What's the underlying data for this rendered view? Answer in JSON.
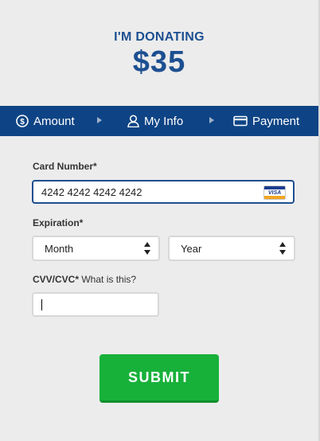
{
  "header": {
    "title": "I'M DONATING",
    "amount": "$35"
  },
  "steps": [
    {
      "label": "Amount",
      "icon": "dollar-circle-icon"
    },
    {
      "label": "My Info",
      "icon": "person-icon"
    },
    {
      "label": "Payment",
      "icon": "credit-card-icon"
    }
  ],
  "form": {
    "card_number_label": "Card Number*",
    "card_number_value": "4242 4242 4242 4242",
    "card_brand": "VISA",
    "expiration_label": "Expiration*",
    "month_value": "Month",
    "year_value": "Year",
    "cvv_label": "CVV/CVC*",
    "cvv_help": "What is this?",
    "cvv_value": ""
  },
  "submit_label": "SUBMIT",
  "colors": {
    "brand_blue": "#0e4485",
    "heading_blue": "#1d4f91",
    "submit_green": "#17b13a"
  }
}
